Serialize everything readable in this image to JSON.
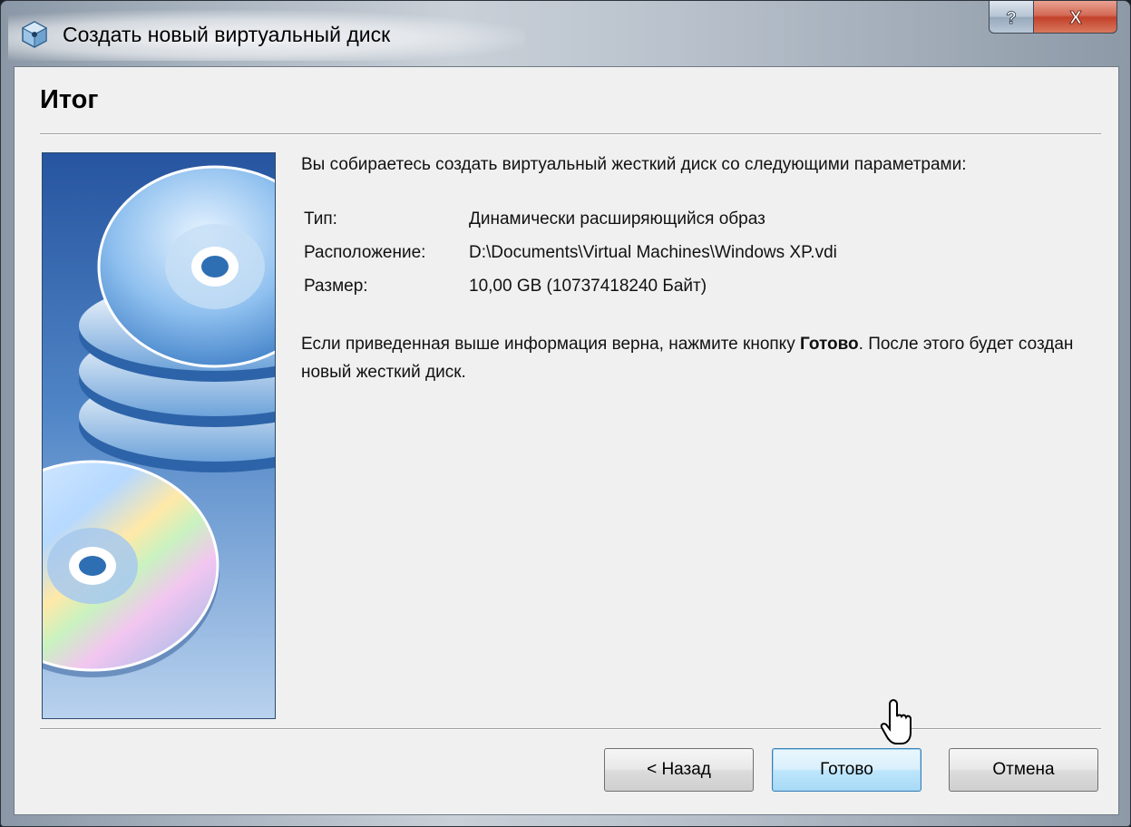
{
  "window": {
    "title": "Создать новый виртуальный диск",
    "help_button": "?",
    "close_button": "X"
  },
  "page": {
    "title": "Итог",
    "intro": "Вы собираетесь создать виртуальный жесткий диск со следующими параметрами:",
    "params": [
      {
        "label": "Тип:",
        "value": "Динамически расширяющийся образ"
      },
      {
        "label": "Расположение:",
        "value": "D:\\Documents\\Virtual Machines\\Windows XP.vdi"
      },
      {
        "label": "Размер:",
        "value": "10,00 GB (10737418240 Байт)"
      }
    ],
    "outro_before": "Если приведенная выше информация верна, нажмите кнопку ",
    "outro_bold": "Готово",
    "outro_after": ". После этого будет создан новый жесткий диск."
  },
  "buttons": {
    "back": "< Назад",
    "finish": "Готово",
    "cancel": "Отмена"
  },
  "icons": {
    "app": "virtualbox-cube-icon",
    "help": "question-mark-icon",
    "close": "close-x-icon",
    "watermark": "stacked-discs-illustration",
    "cursor": "mouse-pointer-icon"
  },
  "colors": {
    "watermark_bg": "#2a5fa8",
    "finish_button_border": "#3c7fb1",
    "close_button": "#c2412a"
  }
}
